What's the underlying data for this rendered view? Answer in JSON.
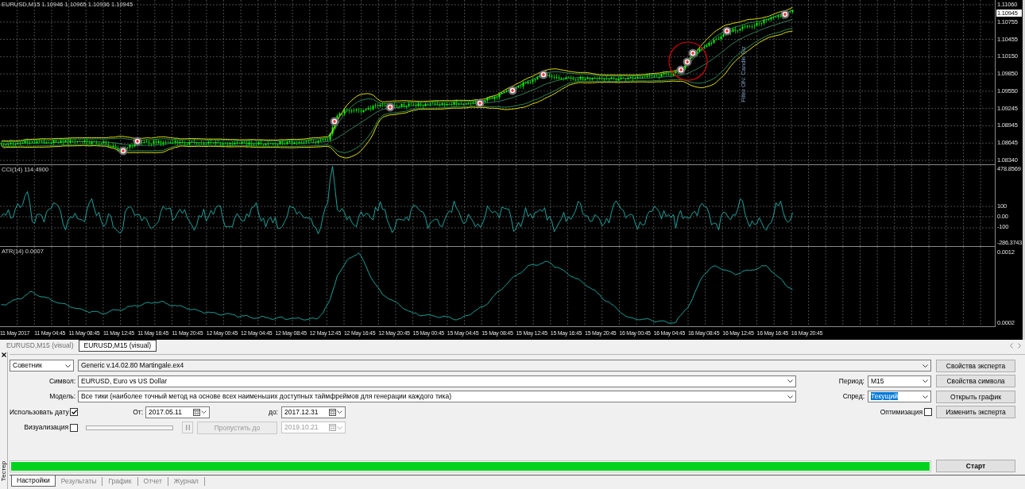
{
  "chart": {
    "header": "EURUSD,M15 1.10946 1.10965 1.10936 1.10945",
    "annotation": "Filter ON: Candle Siz",
    "price_axis": [
      "1.11060",
      "1.10755",
      "1.10455",
      "1.10150",
      "1.09850",
      "1.09550",
      "1.09245",
      "1.08945",
      "1.08645",
      "1.08340"
    ],
    "current_price": "1.10945",
    "cci": {
      "header": "CCI(14) 114.4900",
      "axis": [
        "478.8569",
        "100",
        "0.00",
        "-100",
        "-286.3743"
      ]
    },
    "atr": {
      "header": "ATR(14) 0.0007",
      "axis": [
        "0.0012",
        "0.0002"
      ]
    },
    "time_axis": [
      "11 May 2017",
      "11 May 04:45",
      "11 May 08:45",
      "11 May 12:45",
      "11 May 16:45",
      "11 May 20:45",
      "12 May 00:45",
      "12 May 04:45",
      "12 May 08:45",
      "12 May 12:45",
      "12 May 16:45",
      "12 May 20:45",
      "15 May 00:45",
      "15 May 04:45",
      "15 May 08:45",
      "15 May 12:45",
      "15 May 16:45",
      "15 May 20:45",
      "16 May 00:45",
      "16 May 04:45",
      "16 May 08:45",
      "16 May 12:45",
      "16 May 16:45",
      "16 May 20:45"
    ]
  },
  "chart_tabs": [
    {
      "label": "EURUSD,M15 (visual)",
      "selected": false
    },
    {
      "label": "EURUSD,M15 (visual)",
      "selected": true
    }
  ],
  "tester": {
    "title": "Тестер",
    "mode": {
      "value": "Советник"
    },
    "expert": {
      "value": "Generic v.14.02.80 Martingale.ex4"
    },
    "symbol": {
      "label": "Символ:",
      "value": "EURUSD, Euro vs US Dollar"
    },
    "model": {
      "label": "Модель:",
      "value": "Все тики (наиболее точный метод на основе всех наименьших доступных таймфреймов для генерации каждого тика)"
    },
    "period": {
      "label": "Период:",
      "value": "M15"
    },
    "spread": {
      "label": "Спред:",
      "value": "Текущий",
      "highlighted": true
    },
    "use_date": {
      "label": "Использовать дату",
      "checked": true
    },
    "date_from": {
      "label": "От:",
      "value": "2017.05.11"
    },
    "date_to": {
      "label": "до:",
      "value": "2017.12.31"
    },
    "optimization": {
      "label": "Оптимизация",
      "checked": false
    },
    "visualization": {
      "label": "Визуализация",
      "checked": false
    },
    "pause_button": {
      "disabled": true
    },
    "skip_button": {
      "label": "Пропустить до",
      "disabled": true
    },
    "skip_date": {
      "value": "2019.10.21",
      "disabled": true
    },
    "side_buttons": [
      "Свойства эксперта",
      "Свойства символа",
      "Открыть график",
      "Изменить эксперта"
    ],
    "progress": {
      "level": 1
    },
    "start_button": "Старт",
    "tabs": [
      {
        "label": "Настройки",
        "selected": true
      },
      {
        "label": "Результаты",
        "selected": false
      },
      {
        "label": "График",
        "selected": false
      },
      {
        "label": "Отчет",
        "selected": false
      },
      {
        "label": "Журнал",
        "selected": false
      }
    ]
  }
}
